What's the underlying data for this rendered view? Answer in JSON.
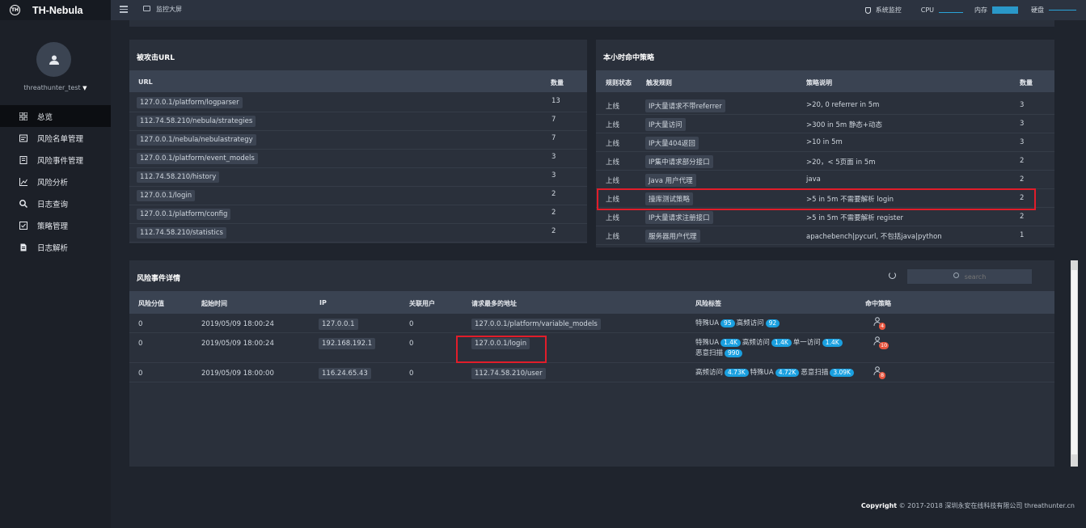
{
  "brand": {
    "logo_text": "TH",
    "name": "TH-Nebula"
  },
  "user": {
    "name": "threathunter_test"
  },
  "menu": [
    {
      "label": "总览",
      "icon": "grid-icon",
      "active": true
    },
    {
      "label": "风险名单管理",
      "icon": "list-icon"
    },
    {
      "label": "风险事件管理",
      "icon": "document-icon"
    },
    {
      "label": "风险分析",
      "icon": "chart-icon"
    },
    {
      "label": "日志查询",
      "icon": "search-icon"
    },
    {
      "label": "策略管理",
      "icon": "checklist-icon"
    },
    {
      "label": "日志解析",
      "icon": "file-icon"
    }
  ],
  "topbar": {
    "monitor_label": "监控大屏",
    "system_monitor": "系统监控",
    "cpu": "CPU",
    "memory": "内存",
    "disk": "硬盘"
  },
  "attacked_urls": {
    "title": "被攻击URL",
    "headers": {
      "url": "URL",
      "count": "数量"
    },
    "rows": [
      {
        "url": "127.0.0.1/platform/logparser",
        "count": "13"
      },
      {
        "url": "112.74.58.210/nebula/strategies",
        "count": "7"
      },
      {
        "url": "127.0.0.1/nebula/nebulastrategy",
        "count": "7"
      },
      {
        "url": "127.0.0.1/platform/event_models",
        "count": "3"
      },
      {
        "url": "112.74.58.210/history",
        "count": "3"
      },
      {
        "url": "127.0.0.1/login",
        "count": "2"
      },
      {
        "url": "127.0.0.1/platform/config",
        "count": "2"
      },
      {
        "url": "112.74.58.210/statistics",
        "count": "2"
      }
    ]
  },
  "strategies": {
    "title": "本小时命中策略",
    "headers": {
      "status": "规则状态",
      "rule": "触发规则",
      "desc": "策略说明",
      "count": "数量"
    },
    "rows": [
      {
        "status": "上线",
        "rule": "IP大量请求不带referrer",
        "desc": ">20, 0 referrer in 5m",
        "count": "3"
      },
      {
        "status": "上线",
        "rule": "IP大量访问",
        "desc": ">300 in 5m 静态+动态",
        "count": "3"
      },
      {
        "status": "上线",
        "rule": "IP大量404返回",
        "desc": ">10 in 5m",
        "count": "3"
      },
      {
        "status": "上线",
        "rule": "IP集中请求部分接口",
        "desc": ">20，< 5页面 in 5m",
        "count": "2"
      },
      {
        "status": "上线",
        "rule": "Java 用户代理",
        "desc": "java",
        "count": "2"
      },
      {
        "status": "上线",
        "rule": "撞库测试策略",
        "desc": ">5 in 5m 不需要解析 login",
        "count": "2"
      },
      {
        "status": "上线",
        "rule": "IP大量请求注册接口",
        "desc": ">5 in 5m 不需要解析 register",
        "count": "2"
      },
      {
        "status": "上线",
        "rule": "服务器用户代理",
        "desc": "apachebench|pycurl, 不包括java|python",
        "count": "1"
      }
    ]
  },
  "events": {
    "title": "风险事件详情",
    "search_placeholder": "search",
    "headers": {
      "score": "风险分值",
      "time": "起始时间",
      "ip": "IP",
      "users": "关联用户",
      "url": "请求最多的地址",
      "tags": "风险标签",
      "hit": "命中策略"
    },
    "rows": [
      {
        "score": "0",
        "time": "2019/05/09 18:00:24",
        "ip": "127.0.0.1",
        "users": "0",
        "url": "127.0.0.1/platform/variable_models",
        "tags": [
          {
            "name": "特殊UA",
            "count": "95"
          },
          {
            "name": "高频访问",
            "count": "92"
          }
        ],
        "hit": "4"
      },
      {
        "score": "0",
        "time": "2019/05/09 18:00:24",
        "ip": "192.168.192.1",
        "users": "0",
        "url": "127.0.0.1/login",
        "tags": [
          {
            "name": "特殊UA",
            "count": "1.4K"
          },
          {
            "name": "高频访问",
            "count": "1.4K"
          },
          {
            "name": "单一访问",
            "count": "1.4K"
          },
          {
            "name": "恶意扫描",
            "count": "990"
          }
        ],
        "hit": "10"
      },
      {
        "score": "0",
        "time": "2019/05/09 18:00:00",
        "ip": "116.24.65.43",
        "users": "0",
        "url": "112.74.58.210/user",
        "tags": [
          {
            "name": "高频访问",
            "count": "4.73K"
          },
          {
            "name": "特殊UA",
            "count": "4.72K"
          },
          {
            "name": "恶意扫描",
            "count": "3.09K"
          }
        ],
        "hit": "8"
      }
    ]
  },
  "footer": {
    "copyright_bold": "Copyright",
    "copyright_text": "© 2017-2018 深圳永安在线科技有限公司 threathunter.cn"
  },
  "colors": {
    "accent": "#1aa0e0",
    "highlight": "#e11d2a",
    "hit_badge": "#e8553f"
  }
}
